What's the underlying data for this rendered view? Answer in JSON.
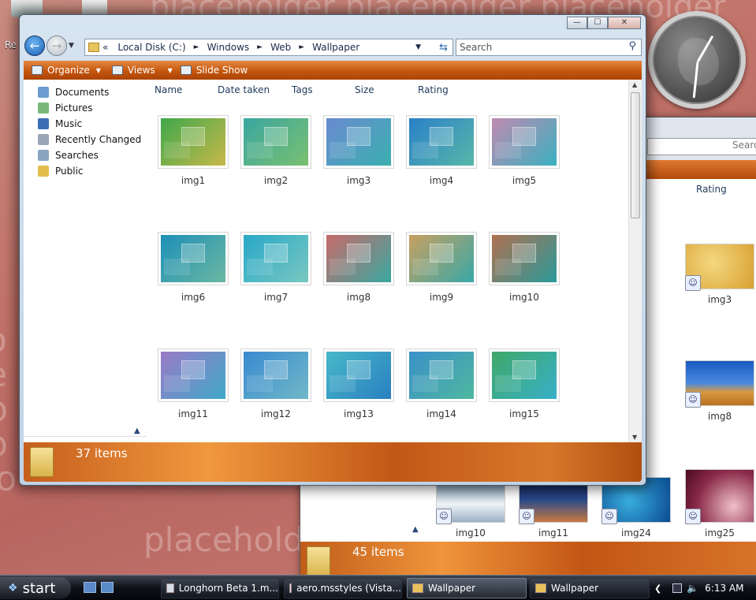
{
  "desktop": {
    "watermark_top": "placeholder placeholder placeholder",
    "watermark_bottom": "placeholder",
    "watermark_left": "o\ne\np\np\nlo",
    "recycle_label": "Re"
  },
  "window": {
    "caption": {
      "minimize": "—",
      "maximize": "☐",
      "close": "✕"
    },
    "nav": {
      "back": "←",
      "forward": "→"
    },
    "address": {
      "breadcrumb": [
        "Local Disk (C:)",
        "Windows",
        "Web",
        "Wallpaper"
      ],
      "sep": "►",
      "lead": "«"
    },
    "search_placeholder": "Search",
    "toolbar": {
      "organize": "Organize",
      "views": "Views",
      "slideshow": "Slide Show"
    },
    "navpane": [
      {
        "label": "Documents",
        "color": "#6b9bd1"
      },
      {
        "label": "Pictures",
        "color": "#7ab87a"
      },
      {
        "label": "Music",
        "color": "#3b6fb5"
      },
      {
        "label": "Recently Changed",
        "color": "#9aa6b5"
      },
      {
        "label": "Searches",
        "color": "#8aa4c0"
      },
      {
        "label": "Public",
        "color": "#e2bd4e"
      }
    ],
    "columns": [
      "Name",
      "Date taken",
      "Tags",
      "Size",
      "Rating"
    ],
    "thumbs": [
      {
        "label": "img1",
        "c1": "#3fa84a",
        "c2": "#c8b84a"
      },
      {
        "label": "img2",
        "c1": "#3aa6a0",
        "c2": "#7ac070"
      },
      {
        "label": "img3",
        "c1": "#6a8ad0",
        "c2": "#3ab0b0"
      },
      {
        "label": "img4",
        "c1": "#2a80c8",
        "c2": "#58b8a8"
      },
      {
        "label": "img5",
        "c1": "#c08ab0",
        "c2": "#3ab0c0"
      },
      {
        "label": "img6",
        "c1": "#1e8fb8",
        "c2": "#6ab8a0"
      },
      {
        "label": "img7",
        "c1": "#28a8c8",
        "c2": "#7ac8c0"
      },
      {
        "label": "img8",
        "c1": "#c86a6a",
        "c2": "#38a8a0"
      },
      {
        "label": "img9",
        "c1": "#c8a060",
        "c2": "#38a8a8"
      },
      {
        "label": "img10",
        "c1": "#b07050",
        "c2": "#2a9a9a"
      },
      {
        "label": "img11",
        "c1": "#9a7ac8",
        "c2": "#40a8c8"
      },
      {
        "label": "img12",
        "c1": "#3a8ad0",
        "c2": "#70b8c8"
      },
      {
        "label": "img13",
        "c1": "#48b8c8",
        "c2": "#2a80c0"
      },
      {
        "label": "img14",
        "c1": "#3a90c8",
        "c2": "#50b8a0"
      },
      {
        "label": "img15",
        "c1": "#40a868",
        "c2": "#38b0c8"
      }
    ],
    "status": "37 items"
  },
  "back_window": {
    "search_placeholder": "Search",
    "rating": "Rating",
    "thumbs": [
      {
        "label": "img3",
        "c1": "#e8b84a",
        "c2": "#f0d070"
      },
      {
        "label": "img8",
        "c1": "#2a6ad0",
        "c2": "#e0a040"
      },
      {
        "label": "img10",
        "c1": "#6a8aa8",
        "c2": "#eef4f8"
      },
      {
        "label": "img11",
        "c1": "#1a2a5a",
        "c2": "#d08040"
      },
      {
        "label": "img24",
        "c1": "#1a6ab0",
        "c2": "#3ab0e0"
      },
      {
        "label": "img25",
        "c1": "#6a1a3a",
        "c2": "#e8a0b0"
      }
    ],
    "status": "45 items"
  },
  "taskbar": {
    "start": "start",
    "buttons": [
      "Longhorn Beta 1.m...",
      "aero.msstyles (Vista...",
      "Wallpaper",
      "Wallpaper"
    ],
    "clock": "6:13 AM"
  }
}
